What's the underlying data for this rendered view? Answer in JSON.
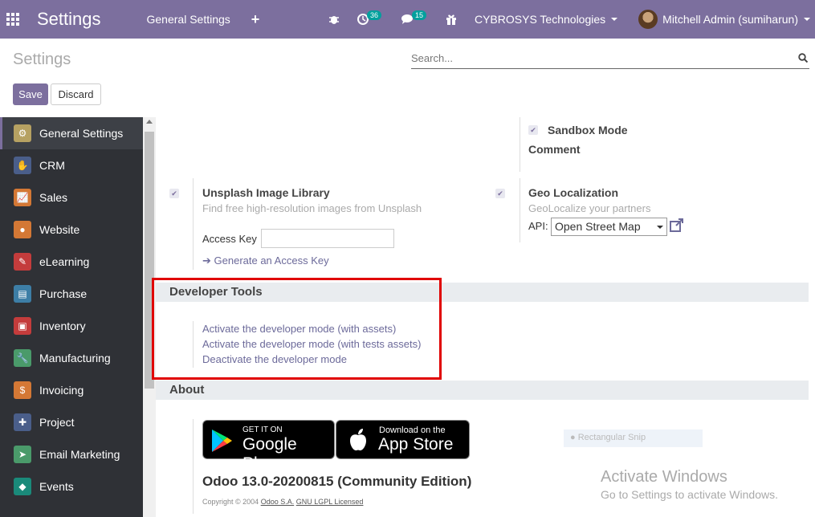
{
  "navbar": {
    "brand": "Settings",
    "menu": "General Settings",
    "plus": "+",
    "activity_count": "36",
    "message_count": "15",
    "company": "CYBROSYS Technologies",
    "user": "Mitchell Admin (sumiharun)"
  },
  "control_panel": {
    "title": "Settings",
    "search_placeholder": "Search...",
    "save_label": "Save",
    "discard_label": "Discard"
  },
  "sidebar": {
    "items": [
      {
        "label": "General Settings",
        "icon": "gear-icon",
        "color": "#b6a162"
      },
      {
        "label": "CRM",
        "icon": "handshake-icon",
        "color": "#4a5e8a"
      },
      {
        "label": "Sales",
        "icon": "chart-icon",
        "color": "#d47835"
      },
      {
        "label": "Website",
        "icon": "globe-icon",
        "color": "#d47835"
      },
      {
        "label": "eLearning",
        "icon": "learning-icon",
        "color": "#c43c3c"
      },
      {
        "label": "Purchase",
        "icon": "card-icon",
        "color": "#3d7ea6"
      },
      {
        "label": "Inventory",
        "icon": "box-icon",
        "color": "#c43c3c"
      },
      {
        "label": "Manufacturing",
        "icon": "wrench-icon",
        "color": "#4a9a6a"
      },
      {
        "label": "Invoicing",
        "icon": "invoice-icon",
        "color": "#d47835"
      },
      {
        "label": "Project",
        "icon": "puzzle-icon",
        "color": "#4a5e8a"
      },
      {
        "label": "Email Marketing",
        "icon": "paper-plane-icon",
        "color": "#4a9a6a"
      },
      {
        "label": "Events",
        "icon": "ticket-icon",
        "color": "#1a8a7a"
      }
    ]
  },
  "content": {
    "sandbox_mode": "Sandbox Mode",
    "comment": "Comment",
    "unsplash_title": "Unsplash Image Library",
    "unsplash_desc": "Find free high-resolution images from Unsplash",
    "access_key_label": "Access Key",
    "generate_link": "Generate an Access Key",
    "geo_title": "Geo Localization",
    "geo_desc": "GeoLocalize your partners",
    "api_label": "API:",
    "api_value": "Open Street Map",
    "developer_tools_title": "Developer Tools",
    "dev_links": [
      "Activate the developer mode (with assets)",
      "Activate the developer mode (with tests assets)",
      "Deactivate the developer mode"
    ],
    "about_title": "About",
    "google_small": "GET IT ON",
    "google_big": "Google Play",
    "apple_small": "Download on the",
    "apple_big": "App Store",
    "version": "Odoo 13.0-20200815 (Community Edition)",
    "copyright_prefix": "Copyright © 2004",
    "copyright_company": "Odoo S.A.",
    "copyright_license": "GNU LGPL Licensed",
    "snip_label": "Rectangular Snip"
  },
  "watermark": {
    "title": "Activate Windows",
    "subtitle": "Go to Settings to activate Windows."
  }
}
